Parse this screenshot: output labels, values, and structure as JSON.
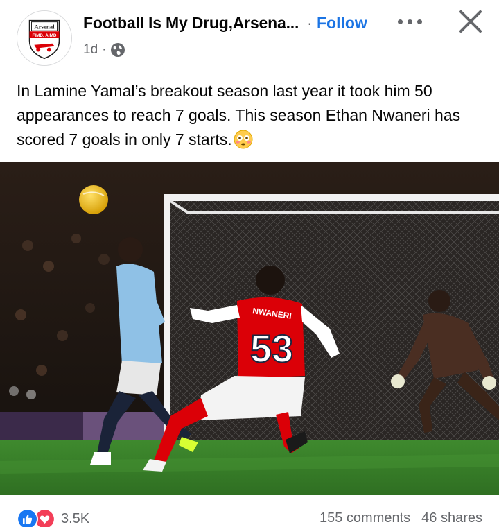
{
  "post": {
    "page_name": "Football Is My Drug,Arsena...",
    "separator": "·",
    "follow_label": "Follow",
    "time": "1d",
    "time_separator": "·",
    "avatar_text_top": "Arsenal",
    "avatar_text_bottom": "FIMD, AIMD",
    "text": "In Lamine Yamal’s breakout season last year it took him 50 appearances to reach 7 goals. This season Ethan Nwaneri has scored 7 goals in only 7 starts.",
    "emoji": "flushed-face",
    "photo": {
      "jersey_name": "NWANERI",
      "jersey_number": "53"
    }
  },
  "engagement": {
    "reaction_count": "3.5K",
    "comments": "155 comments",
    "shares": "46 shares"
  },
  "colors": {
    "follow": "#1b74e4",
    "secondary_text": "#65676b",
    "like": "#1877f2",
    "love": "#f33e58",
    "arsenal_red": "#db0007"
  }
}
